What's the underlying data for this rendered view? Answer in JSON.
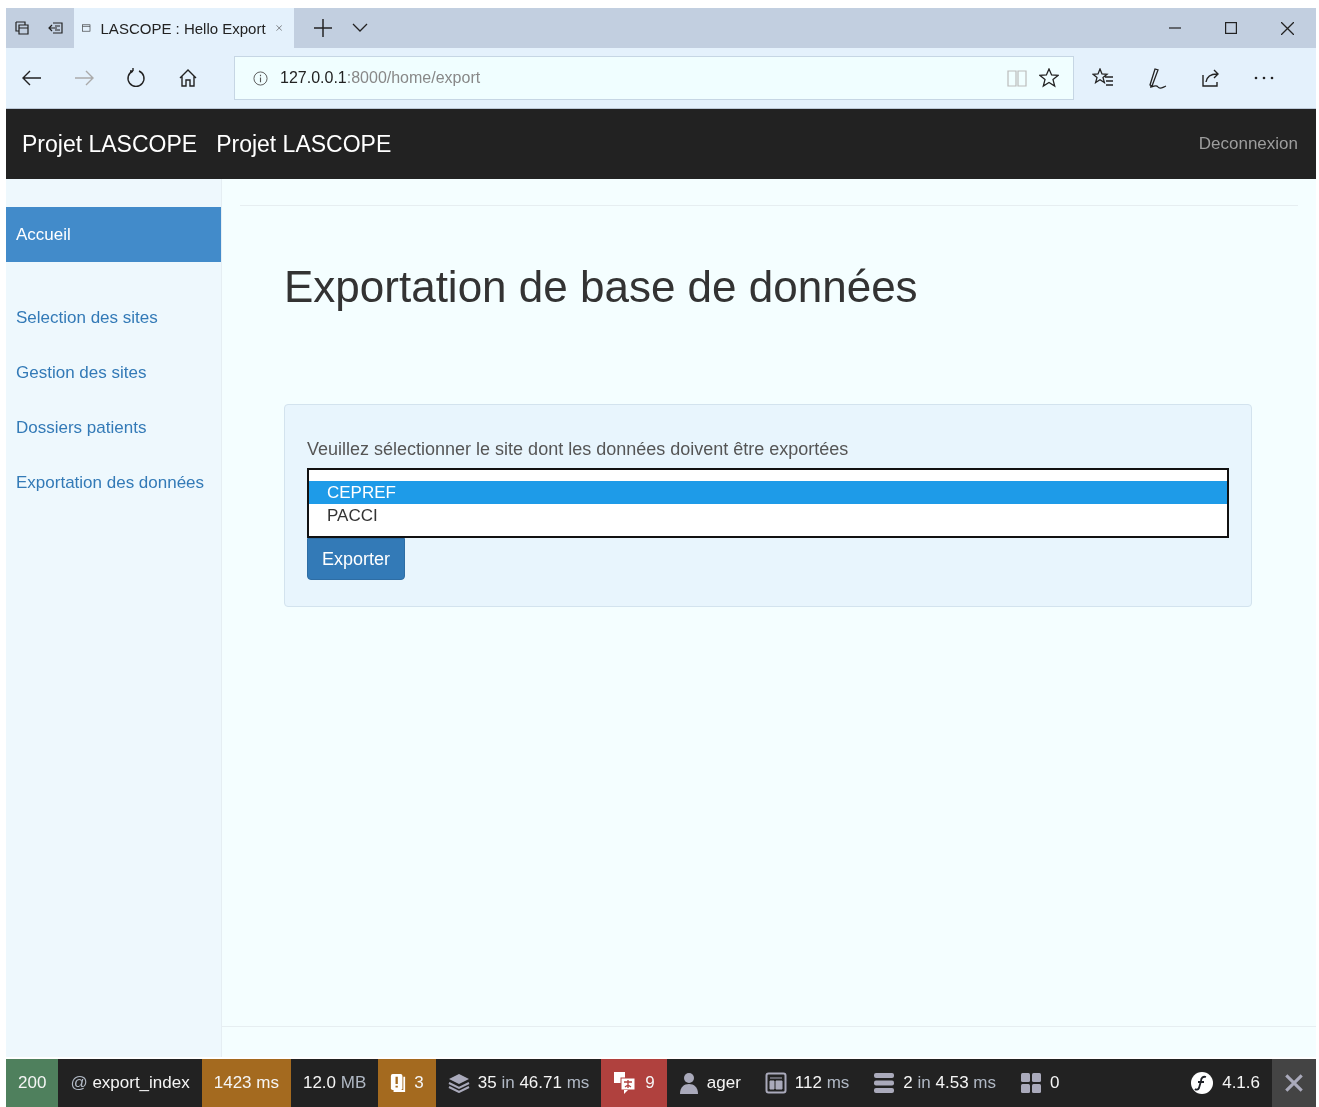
{
  "browser": {
    "tabs": [
      {
        "title": "LASCOPE : Hello Export",
        "selected": true
      }
    ],
    "address": {
      "host": "127.0.0.1",
      "path": ":8000/home/export"
    }
  },
  "navbar": {
    "brand": "Projet LASCOPE",
    "title": "Projet LASCOPE",
    "logout": "Deconnexion"
  },
  "sidebar": {
    "items": [
      {
        "label": "Accueil",
        "selected": true
      },
      {
        "label": "Selection des sites",
        "selected": false
      },
      {
        "label": "Gestion des sites",
        "selected": false
      },
      {
        "label": "Dossiers patients",
        "selected": false
      },
      {
        "label": "Exportation des données",
        "selected": false
      }
    ]
  },
  "heading": "Exportation de base de données",
  "form": {
    "label": "Veuillez sélectionner le site dont les données doivent être exportées",
    "options": [
      {
        "label": "CEPREF",
        "selected": true
      },
      {
        "label": "PACCI",
        "selected": false
      }
    ],
    "button": "Exporter"
  },
  "debug_toolbar": {
    "items": [
      {
        "kind": "status",
        "color": "#4f805d",
        "parts": [
          {
            "text": "200",
            "muted": false
          }
        ]
      },
      {
        "kind": "route",
        "parts": [
          {
            "text": "@",
            "muted": true
          },
          {
            "text": "export_index",
            "muted": false
          }
        ]
      },
      {
        "kind": "time",
        "color": "#a46a1f",
        "parts": [
          {
            "text": "1423",
            "muted": false
          },
          {
            "text": "ms",
            "muted": false
          }
        ]
      },
      {
        "kind": "memory",
        "parts": [
          {
            "text": "12.0",
            "muted": false
          },
          {
            "text": "MB",
            "muted": true
          }
        ]
      },
      {
        "kind": "logs",
        "color": "#a46a1f",
        "parts": [
          {
            "text": "3",
            "muted": false
          }
        ]
      },
      {
        "kind": "database",
        "parts": [
          {
            "text": "35",
            "muted": false
          },
          {
            "text": "in",
            "muted": true
          },
          {
            "text": "46.71",
            "muted": false
          },
          {
            "text": "ms",
            "muted": true
          }
        ]
      },
      {
        "kind": "translation",
        "color": "#b0413e",
        "parts": [
          {
            "text": "9",
            "muted": false
          }
        ]
      },
      {
        "kind": "user",
        "parts": [
          {
            "text": "ager",
            "muted": false
          }
        ]
      },
      {
        "kind": "twig",
        "parts": [
          {
            "text": "112",
            "muted": false
          },
          {
            "text": "ms",
            "muted": true
          }
        ]
      },
      {
        "kind": "cache",
        "parts": [
          {
            "text": "2",
            "muted": false
          },
          {
            "text": "in",
            "muted": true
          },
          {
            "text": "4.53",
            "muted": false
          },
          {
            "text": "ms",
            "muted": true
          }
        ]
      },
      {
        "kind": "forms",
        "parts": [
          {
            "text": "0",
            "muted": false
          }
        ]
      },
      {
        "kind": "version",
        "parts": [
          {
            "text": "4.1.6",
            "muted": false
          }
        ]
      }
    ]
  }
}
